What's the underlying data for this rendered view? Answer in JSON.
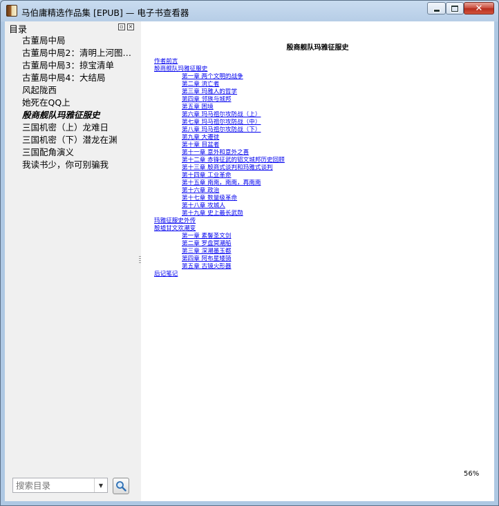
{
  "window": {
    "title": "马伯庸精选作品集 [EPUB] — 电子书查看器",
    "controls": {
      "minimize": "",
      "maximize": "",
      "close": "✕"
    }
  },
  "sidebar": {
    "header": "目录",
    "items": [
      {
        "label": "古董局中局"
      },
      {
        "label": "古董局中局2：清明上河图…"
      },
      {
        "label": "古董局中局3：掠宝清单"
      },
      {
        "label": "古董局中局4：大结局"
      },
      {
        "label": "风起陇西"
      },
      {
        "label": "她死在QQ上"
      },
      {
        "label": "殷商舰队玛雅征服史",
        "current": true
      },
      {
        "label": "三国机密（上）龙难日"
      },
      {
        "label": "三国机密（下）潜龙在渊"
      },
      {
        "label": "三国配角演义"
      },
      {
        "label": "我读书少，你可别骗我"
      }
    ],
    "search": {
      "placeholder": "搜索目录"
    }
  },
  "content": {
    "title": "殷商舰队玛雅征服史",
    "links": [
      {
        "text": "作者前言",
        "level": 1
      },
      {
        "text": "殷商舰队玛雅征服史",
        "level": 1
      },
      {
        "text": "第一章 两个文明的战争",
        "level": 2
      },
      {
        "text": "第二章 流亡者",
        "level": 2
      },
      {
        "text": "第三章 玛雅人的哲学",
        "level": 2
      },
      {
        "text": "第四章 邻族与城邦",
        "level": 2
      },
      {
        "text": "第五章 困境",
        "level": 2
      },
      {
        "text": "第六章 玛马祖尔攻防战（上）",
        "level": 2
      },
      {
        "text": "第七章 玛马祖尔攻防战（中）",
        "level": 2
      },
      {
        "text": "第八章 玛马祖尔攻防战（下）",
        "level": 2
      },
      {
        "text": "第九章 大遷徙",
        "level": 2
      },
      {
        "text": "第十章 目盆者",
        "level": 2
      },
      {
        "text": "第十一章 意外和意外之喜",
        "level": 2
      },
      {
        "text": "第十二章 赤锋征武的铝文城邦历史回顾",
        "level": 2
      },
      {
        "text": "第十三章 殷商式谈判和玛雅式谈判",
        "level": 2
      },
      {
        "text": "第十四章 工业革命",
        "level": 2
      },
      {
        "text": "第十五章 南南，南南，再南南",
        "level": 2
      },
      {
        "text": "第十六章 政治",
        "level": 2
      },
      {
        "text": "第十七章 数量级革命",
        "level": 2
      },
      {
        "text": "第十八章 攻城人",
        "level": 2
      },
      {
        "text": "第十九章 史上最长武勋",
        "level": 2
      },
      {
        "text": "玛雅征服史外传",
        "level": 1
      },
      {
        "text": "殷墟甘文欢潮变",
        "level": 1
      },
      {
        "text": "第一章 素馨圣文剑",
        "level": 2
      },
      {
        "text": "第二章 罗盘冥潮船",
        "level": 2
      },
      {
        "text": "第三章 深潮墨玉都",
        "level": 2
      },
      {
        "text": "第四章 阿布星矮骑",
        "level": 2
      },
      {
        "text": "第五章 古镜火形器",
        "level": 2
      },
      {
        "text": "后记笔记",
        "level": 1
      }
    ]
  },
  "status": {
    "zoom": "56%"
  },
  "colors": {
    "link": "#0000ee",
    "close_button": "#c8493a",
    "sidebar_bg": "#f0f0f0"
  }
}
